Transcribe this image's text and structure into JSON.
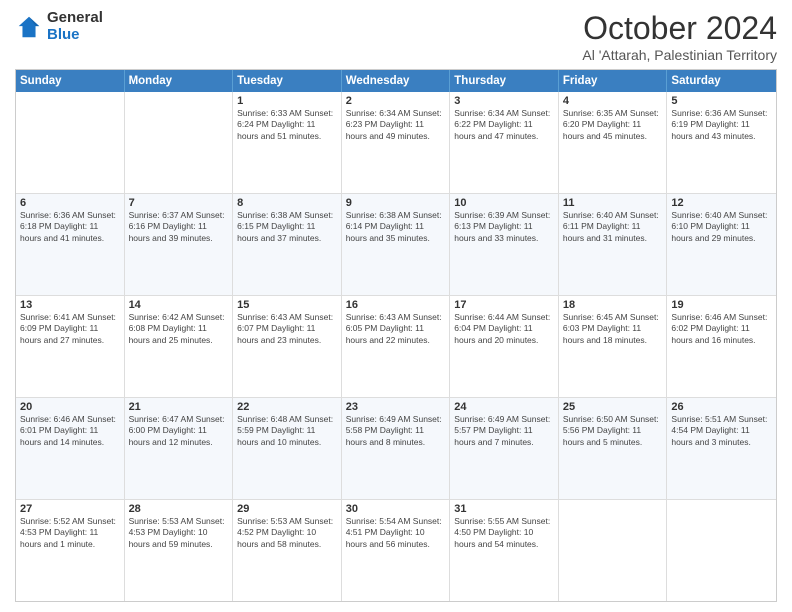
{
  "logo": {
    "general": "General",
    "blue": "Blue"
  },
  "header": {
    "month": "October 2024",
    "location": "Al 'Attarah, Palestinian Territory"
  },
  "days": [
    "Sunday",
    "Monday",
    "Tuesday",
    "Wednesday",
    "Thursday",
    "Friday",
    "Saturday"
  ],
  "weeks": [
    [
      {
        "day": "",
        "detail": ""
      },
      {
        "day": "",
        "detail": ""
      },
      {
        "day": "1",
        "detail": "Sunrise: 6:33 AM\nSunset: 6:24 PM\nDaylight: 11 hours and 51 minutes."
      },
      {
        "day": "2",
        "detail": "Sunrise: 6:34 AM\nSunset: 6:23 PM\nDaylight: 11 hours and 49 minutes."
      },
      {
        "day": "3",
        "detail": "Sunrise: 6:34 AM\nSunset: 6:22 PM\nDaylight: 11 hours and 47 minutes."
      },
      {
        "day": "4",
        "detail": "Sunrise: 6:35 AM\nSunset: 6:20 PM\nDaylight: 11 hours and 45 minutes."
      },
      {
        "day": "5",
        "detail": "Sunrise: 6:36 AM\nSunset: 6:19 PM\nDaylight: 11 hours and 43 minutes."
      }
    ],
    [
      {
        "day": "6",
        "detail": "Sunrise: 6:36 AM\nSunset: 6:18 PM\nDaylight: 11 hours and 41 minutes."
      },
      {
        "day": "7",
        "detail": "Sunrise: 6:37 AM\nSunset: 6:16 PM\nDaylight: 11 hours and 39 minutes."
      },
      {
        "day": "8",
        "detail": "Sunrise: 6:38 AM\nSunset: 6:15 PM\nDaylight: 11 hours and 37 minutes."
      },
      {
        "day": "9",
        "detail": "Sunrise: 6:38 AM\nSunset: 6:14 PM\nDaylight: 11 hours and 35 minutes."
      },
      {
        "day": "10",
        "detail": "Sunrise: 6:39 AM\nSunset: 6:13 PM\nDaylight: 11 hours and 33 minutes."
      },
      {
        "day": "11",
        "detail": "Sunrise: 6:40 AM\nSunset: 6:11 PM\nDaylight: 11 hours and 31 minutes."
      },
      {
        "day": "12",
        "detail": "Sunrise: 6:40 AM\nSunset: 6:10 PM\nDaylight: 11 hours and 29 minutes."
      }
    ],
    [
      {
        "day": "13",
        "detail": "Sunrise: 6:41 AM\nSunset: 6:09 PM\nDaylight: 11 hours and 27 minutes."
      },
      {
        "day": "14",
        "detail": "Sunrise: 6:42 AM\nSunset: 6:08 PM\nDaylight: 11 hours and 25 minutes."
      },
      {
        "day": "15",
        "detail": "Sunrise: 6:43 AM\nSunset: 6:07 PM\nDaylight: 11 hours and 23 minutes."
      },
      {
        "day": "16",
        "detail": "Sunrise: 6:43 AM\nSunset: 6:05 PM\nDaylight: 11 hours and 22 minutes."
      },
      {
        "day": "17",
        "detail": "Sunrise: 6:44 AM\nSunset: 6:04 PM\nDaylight: 11 hours and 20 minutes."
      },
      {
        "day": "18",
        "detail": "Sunrise: 6:45 AM\nSunset: 6:03 PM\nDaylight: 11 hours and 18 minutes."
      },
      {
        "day": "19",
        "detail": "Sunrise: 6:46 AM\nSunset: 6:02 PM\nDaylight: 11 hours and 16 minutes."
      }
    ],
    [
      {
        "day": "20",
        "detail": "Sunrise: 6:46 AM\nSunset: 6:01 PM\nDaylight: 11 hours and 14 minutes."
      },
      {
        "day": "21",
        "detail": "Sunrise: 6:47 AM\nSunset: 6:00 PM\nDaylight: 11 hours and 12 minutes."
      },
      {
        "day": "22",
        "detail": "Sunrise: 6:48 AM\nSunset: 5:59 PM\nDaylight: 11 hours and 10 minutes."
      },
      {
        "day": "23",
        "detail": "Sunrise: 6:49 AM\nSunset: 5:58 PM\nDaylight: 11 hours and 8 minutes."
      },
      {
        "day": "24",
        "detail": "Sunrise: 6:49 AM\nSunset: 5:57 PM\nDaylight: 11 hours and 7 minutes."
      },
      {
        "day": "25",
        "detail": "Sunrise: 6:50 AM\nSunset: 5:56 PM\nDaylight: 11 hours and 5 minutes."
      },
      {
        "day": "26",
        "detail": "Sunrise: 5:51 AM\nSunset: 4:54 PM\nDaylight: 11 hours and 3 minutes."
      }
    ],
    [
      {
        "day": "27",
        "detail": "Sunrise: 5:52 AM\nSunset: 4:53 PM\nDaylight: 11 hours and 1 minute."
      },
      {
        "day": "28",
        "detail": "Sunrise: 5:53 AM\nSunset: 4:53 PM\nDaylight: 10 hours and 59 minutes."
      },
      {
        "day": "29",
        "detail": "Sunrise: 5:53 AM\nSunset: 4:52 PM\nDaylight: 10 hours and 58 minutes."
      },
      {
        "day": "30",
        "detail": "Sunrise: 5:54 AM\nSunset: 4:51 PM\nDaylight: 10 hours and 56 minutes."
      },
      {
        "day": "31",
        "detail": "Sunrise: 5:55 AM\nSunset: 4:50 PM\nDaylight: 10 hours and 54 minutes."
      },
      {
        "day": "",
        "detail": ""
      },
      {
        "day": "",
        "detail": ""
      }
    ]
  ]
}
